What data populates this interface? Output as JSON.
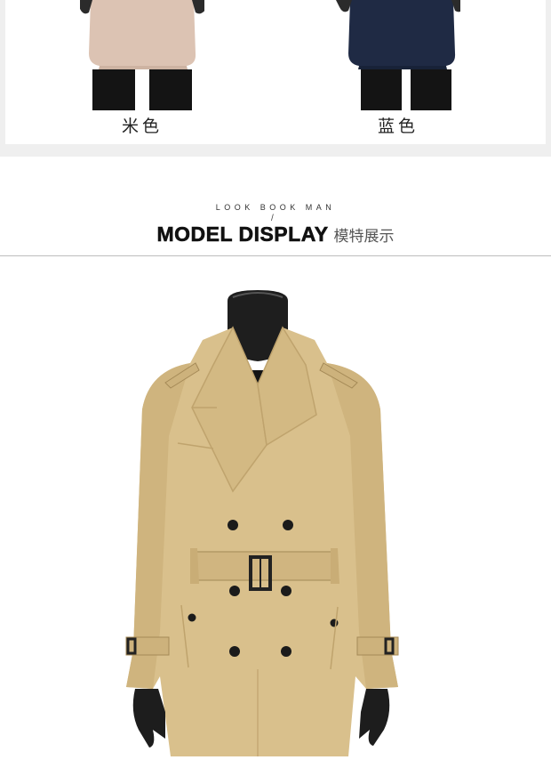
{
  "variants": [
    {
      "label": "米色",
      "color": "#dcc3b3"
    },
    {
      "label": "蓝色",
      "color": "#1f2a44"
    }
  ],
  "section": {
    "subtitle": "LOOK BOOK MAN",
    "slash": "/",
    "title": "MODEL DISPLAY",
    "title_cn": "模特展示"
  },
  "product": {
    "color_name": "khaki",
    "coat_color": "#d9c08c"
  }
}
